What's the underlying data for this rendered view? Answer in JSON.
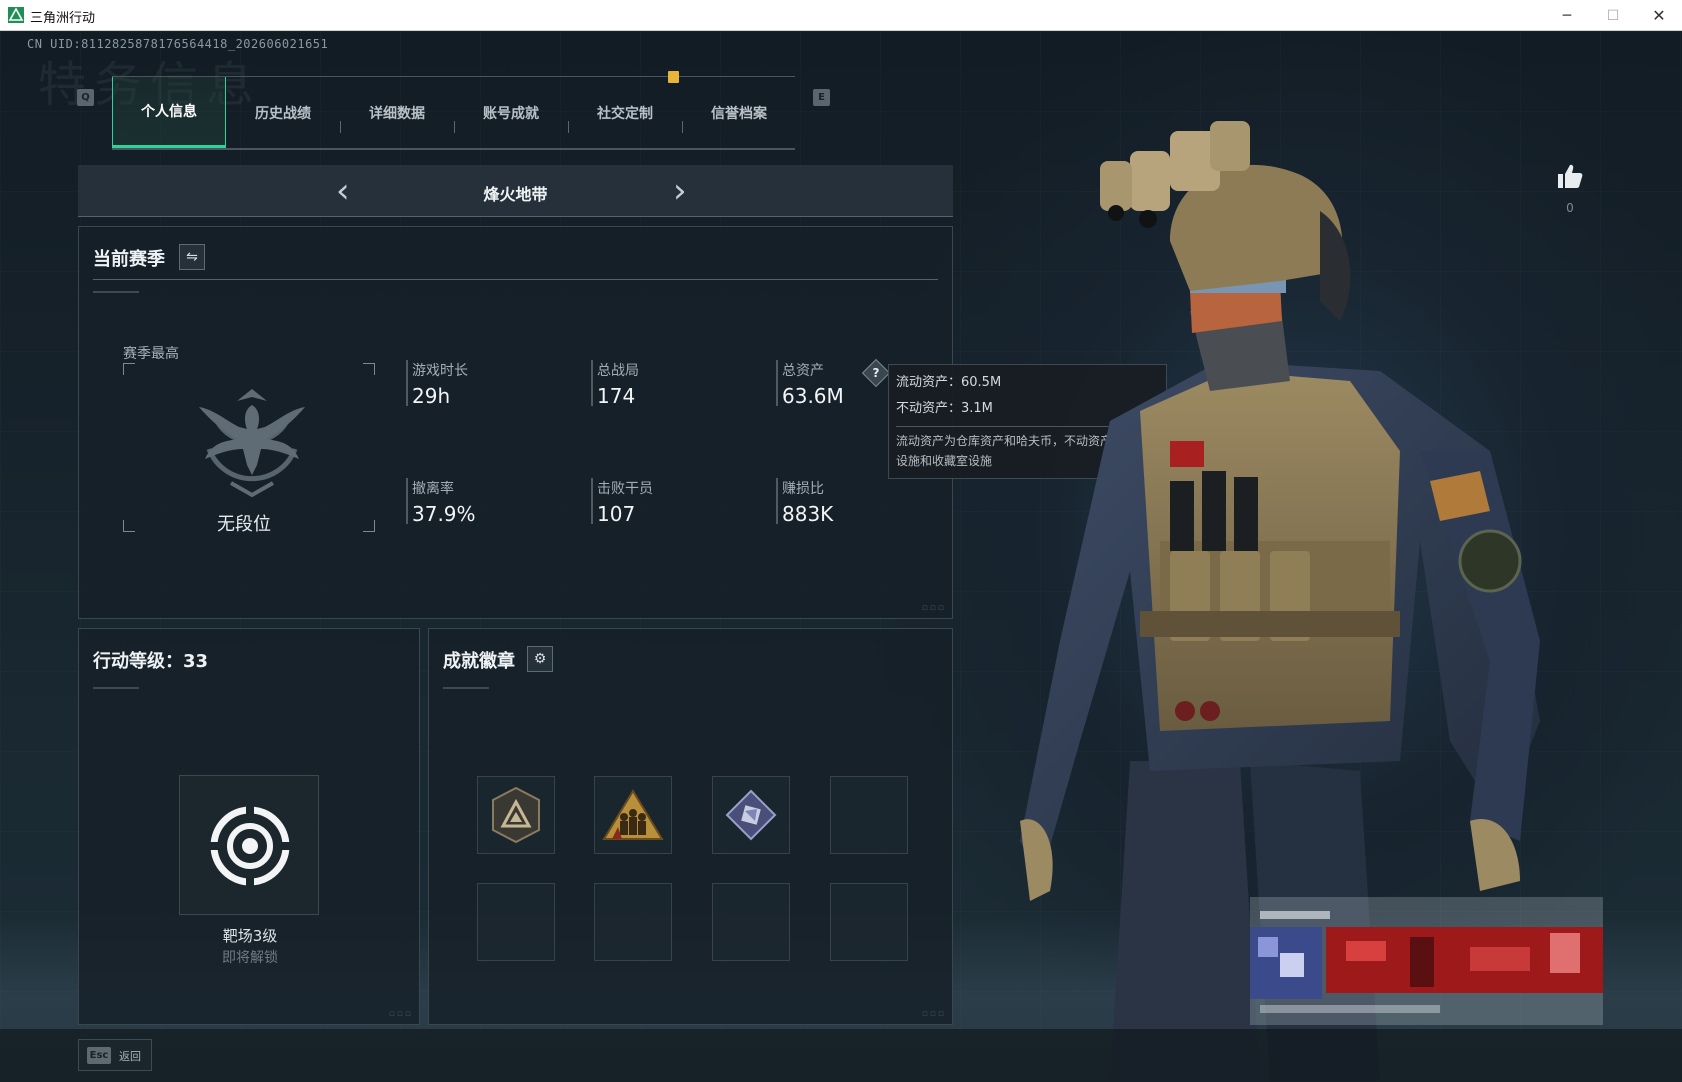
{
  "window": {
    "title": "三角洲行动",
    "min_glyph": "─",
    "max_glyph": "☐",
    "close_glyph": "✕"
  },
  "uid": "CN UID:811282587817656441​8_202606021651",
  "watermark": "特务信息",
  "keys": {
    "prev": "Q",
    "next": "E"
  },
  "tabs": [
    {
      "label": "个人信息",
      "active": true
    },
    {
      "label": "历史战绩"
    },
    {
      "label": "详细数据"
    },
    {
      "label": "账号成就"
    },
    {
      "label": "社交定制"
    },
    {
      "label": "信誉档案"
    }
  ],
  "mode": {
    "title": "烽火地带",
    "prev_glyph": "‹",
    "next_glyph": "›"
  },
  "season": {
    "header": "当前赛季",
    "swap_glyph": "⇋",
    "rank_label": "赛季最高",
    "rank_name": "无段位",
    "stats": [
      {
        "label": "游戏时长",
        "value": "29h"
      },
      {
        "label": "总战局",
        "value": "174"
      },
      {
        "label": "总资产",
        "value": "63.6M"
      },
      {
        "label": "撤离率",
        "value": "37.9%"
      },
      {
        "label": "击败干员",
        "value": "107"
      },
      {
        "label": "赚损比",
        "value": "883K"
      }
    ],
    "help_glyph": "?"
  },
  "tooltip": {
    "liquid": "流动资产：60.5M",
    "fixed": "不动资产：3.1M",
    "desc": "流动资产为仓库资产和哈夫币，不动资产为特勤处设施和收藏室设施"
  },
  "level": {
    "header": "行动等级：33",
    "name": "靶场3级",
    "sub": "即将解锁"
  },
  "badges": {
    "header": "成就徽章",
    "gear_glyph": "⚙",
    "slots": [
      "triangle-badge-icon",
      "soldiers-badge-icon",
      "crystal-badge-icon",
      "",
      "",
      "",
      "",
      ""
    ]
  },
  "like": {
    "count": "0"
  },
  "footer": {
    "esc_key": "Esc",
    "esc_label": "返回"
  },
  "colors": {
    "accent": "#2fd39a",
    "notice": "#e8b53a"
  }
}
